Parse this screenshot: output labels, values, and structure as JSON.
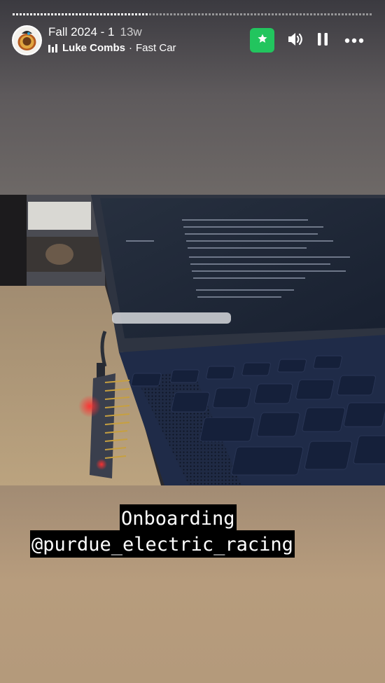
{
  "story": {
    "progress_fraction": 0.38,
    "album_title": "Fall 2024 - 1",
    "age": "13w",
    "music": {
      "artist": "Luke Combs",
      "separator": "·",
      "song": "Fast Car"
    },
    "caption_line1": "Onboarding",
    "caption_line2": "@purdue_electric_racing"
  },
  "icons": {
    "music": "music-bars-icon",
    "star": "star-icon",
    "volume": "volume-icon",
    "pause": "pause-icon",
    "more": "more-icon"
  },
  "colors": {
    "star_button": "#22c55e",
    "caption_bg": "#000000",
    "caption_text": "#ffffff"
  }
}
